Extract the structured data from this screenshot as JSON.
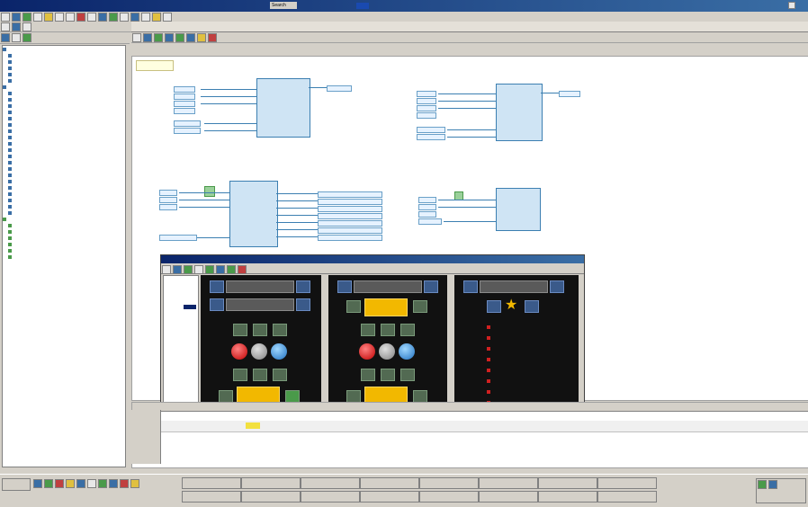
{
  "window": {
    "title": ""
  },
  "toolbar": {
    "search_label": "Search"
  },
  "tree": {
    "items": [
      "",
      "",
      "",
      "",
      "",
      "",
      "",
      "",
      "",
      "",
      "",
      "",
      "",
      "",
      "",
      "",
      "",
      "",
      "",
      "",
      "",
      "",
      "",
      "",
      "",
      "",
      "",
      "",
      "",
      "",
      "",
      "",
      "",
      ""
    ]
  },
  "canvas": {
    "label": ""
  },
  "tool_window": {
    "title": ""
  },
  "taskbar": {
    "buttons": [
      "",
      "",
      "",
      "",
      "",
      "",
      "",
      "",
      "",
      "",
      "",
      "",
      "",
      "",
      "",
      ""
    ]
  }
}
